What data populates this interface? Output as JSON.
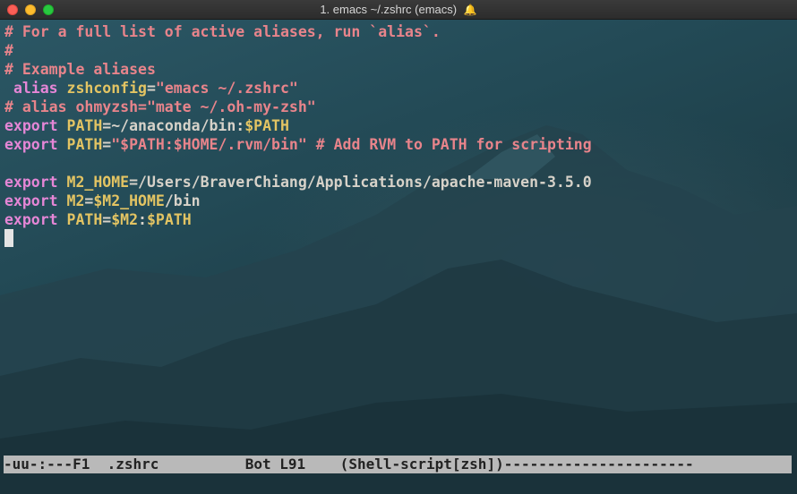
{
  "window": {
    "title": "1. emacs ~/.zshrc (emacs)",
    "title_icon": "bell-icon"
  },
  "editor": {
    "lines": [
      [
        {
          "t": "comment",
          "v": "# For a full list of active aliases, run `alias`."
        }
      ],
      [
        {
          "t": "comment",
          "v": "#"
        }
      ],
      [
        {
          "t": "comment",
          "v": "# Example aliases"
        }
      ],
      [
        {
          "t": "plain",
          "v": " "
        },
        {
          "t": "keyword",
          "v": "alias"
        },
        {
          "t": "plain",
          "v": " "
        },
        {
          "t": "var",
          "v": "zshconfig"
        },
        {
          "t": "plain",
          "v": "="
        },
        {
          "t": "comment",
          "v": "\"emacs ~/.zshrc\""
        }
      ],
      [
        {
          "t": "comment",
          "v": "# alias ohmyzsh=\"mate ~/.oh-my-zsh\""
        }
      ],
      [
        {
          "t": "keyword",
          "v": "export"
        },
        {
          "t": "plain",
          "v": " "
        },
        {
          "t": "var",
          "v": "PATH"
        },
        {
          "t": "plain",
          "v": "=~/anaconda/bin:"
        },
        {
          "t": "var",
          "v": "$PATH"
        }
      ],
      [
        {
          "t": "keyword",
          "v": "export"
        },
        {
          "t": "plain",
          "v": " "
        },
        {
          "t": "var",
          "v": "PATH"
        },
        {
          "t": "plain",
          "v": "="
        },
        {
          "t": "comment",
          "v": "\"$PATH:$HOME/.rvm/bin\""
        },
        {
          "t": "plain",
          "v": " "
        },
        {
          "t": "comment",
          "v": "# Add RVM to PATH for scripting"
        }
      ],
      [],
      [
        {
          "t": "keyword",
          "v": "export"
        },
        {
          "t": "plain",
          "v": " "
        },
        {
          "t": "var",
          "v": "M2_HOME"
        },
        {
          "t": "plain",
          "v": "=/Users/BraverChiang/Applications/apache-maven-3.5.0"
        }
      ],
      [
        {
          "t": "keyword",
          "v": "export"
        },
        {
          "t": "plain",
          "v": " "
        },
        {
          "t": "var",
          "v": "M2"
        },
        {
          "t": "plain",
          "v": "="
        },
        {
          "t": "var",
          "v": "$M2_HOME"
        },
        {
          "t": "plain",
          "v": "/bin"
        }
      ],
      [
        {
          "t": "keyword",
          "v": "export"
        },
        {
          "t": "plain",
          "v": " "
        },
        {
          "t": "var",
          "v": "PATH"
        },
        {
          "t": "plain",
          "v": "="
        },
        {
          "t": "var",
          "v": "$M2"
        },
        {
          "t": "plain",
          "v": ":"
        },
        {
          "t": "var",
          "v": "$PATH"
        }
      ]
    ]
  },
  "modeline": {
    "text": "-uu-:---F1  .zshrc          Bot L91    (Shell-script[zsh])----------------------"
  },
  "colors": {
    "comment": "#e8848b",
    "keyword": "#e586d6",
    "variable": "#e3c463",
    "plain": "#d7d2c9",
    "modeline_bg": "#b9b9b9"
  }
}
